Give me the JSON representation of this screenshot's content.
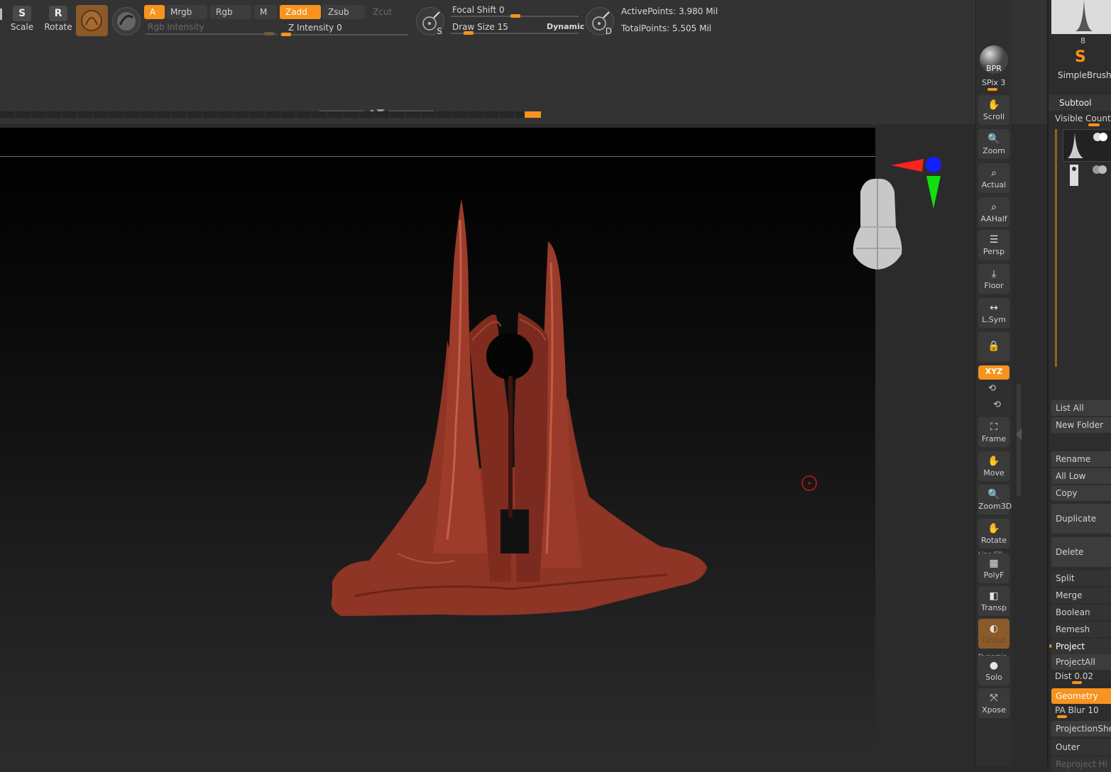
{
  "toolbar": {
    "scale_label": "Scale",
    "rotate_label": "Rotate",
    "a_label": "A",
    "mrgb_label": "Mrgb",
    "rgb_label": "Rgb",
    "m_label": "M",
    "zadd_label": "Zadd",
    "zsub_label": "Zsub",
    "zcut_label": "Zcut",
    "rgb_intensity_label": "Rgb Intensity",
    "z_intensity_label": "Z Intensity 0",
    "focal_shift_label": "Focal Shift 0",
    "draw_size_label": "Draw Size 15",
    "dynamic_label": "Dynamic",
    "s_label": "S",
    "d_label": "D",
    "active_points": "ActivePoints: 3.980 Mil",
    "total_points": "TotalPoints: 5.505 Mil"
  },
  "tools": [
    {
      "name": "bpr",
      "label": "BPR"
    },
    {
      "name": "spix",
      "label": "SPix 3"
    },
    {
      "name": "scroll",
      "label": "Scroll"
    },
    {
      "name": "zoom",
      "label": "Zoom"
    },
    {
      "name": "actual",
      "label": "Actual"
    },
    {
      "name": "aahalf",
      "label": "AAHalf"
    },
    {
      "name": "persp",
      "label": "Persp"
    },
    {
      "name": "floor",
      "label": "Floor"
    },
    {
      "name": "lsym",
      "label": "L.Sym"
    },
    {
      "name": "xyz",
      "label": "XYZ"
    },
    {
      "name": "frame",
      "label": "Frame"
    },
    {
      "name": "move",
      "label": "Move"
    },
    {
      "name": "zoom3d",
      "label": "Zoom3D"
    },
    {
      "name": "rotate",
      "label": "Rotate"
    },
    {
      "name": "polyf",
      "label": "PolyF"
    },
    {
      "name": "transp",
      "label": "Transp"
    },
    {
      "name": "ghost",
      "label": "Ghost"
    },
    {
      "name": "solo",
      "label": "Solo"
    },
    {
      "name": "xpose",
      "label": "Xpose"
    },
    {
      "name": "dynamic",
      "label": "Dynamic"
    },
    {
      "name": "line-fill",
      "label": "Line Fill"
    }
  ],
  "panel": {
    "brush_count": "8",
    "brush_name": "SimpleBrush",
    "subtool_title": "Subtool",
    "visible_count": "Visible Count",
    "list_all": "List All",
    "new_folder": "New Folder",
    "rename": "Rename",
    "all_low": "All Low",
    "copy": "Copy",
    "duplicate": "Duplicate",
    "delete": "Delete",
    "split": "Split",
    "merge": "Merge",
    "boolean": "Boolean",
    "remesh": "Remesh",
    "project": "Project",
    "project_all": "ProjectAll",
    "dist": "Dist 0.02",
    "geometry": "Geometry",
    "pa_blur": "PA Blur 10",
    "projection_shell": "ProjectionShe",
    "outer": "Outer",
    "reproject": "Reproject Hi"
  },
  "colors": {
    "accent": "#f7931e",
    "model": "#9a3a2a",
    "axis_x": "#ff2020",
    "axis_y": "#10e010",
    "axis_z": "#1020ff"
  }
}
